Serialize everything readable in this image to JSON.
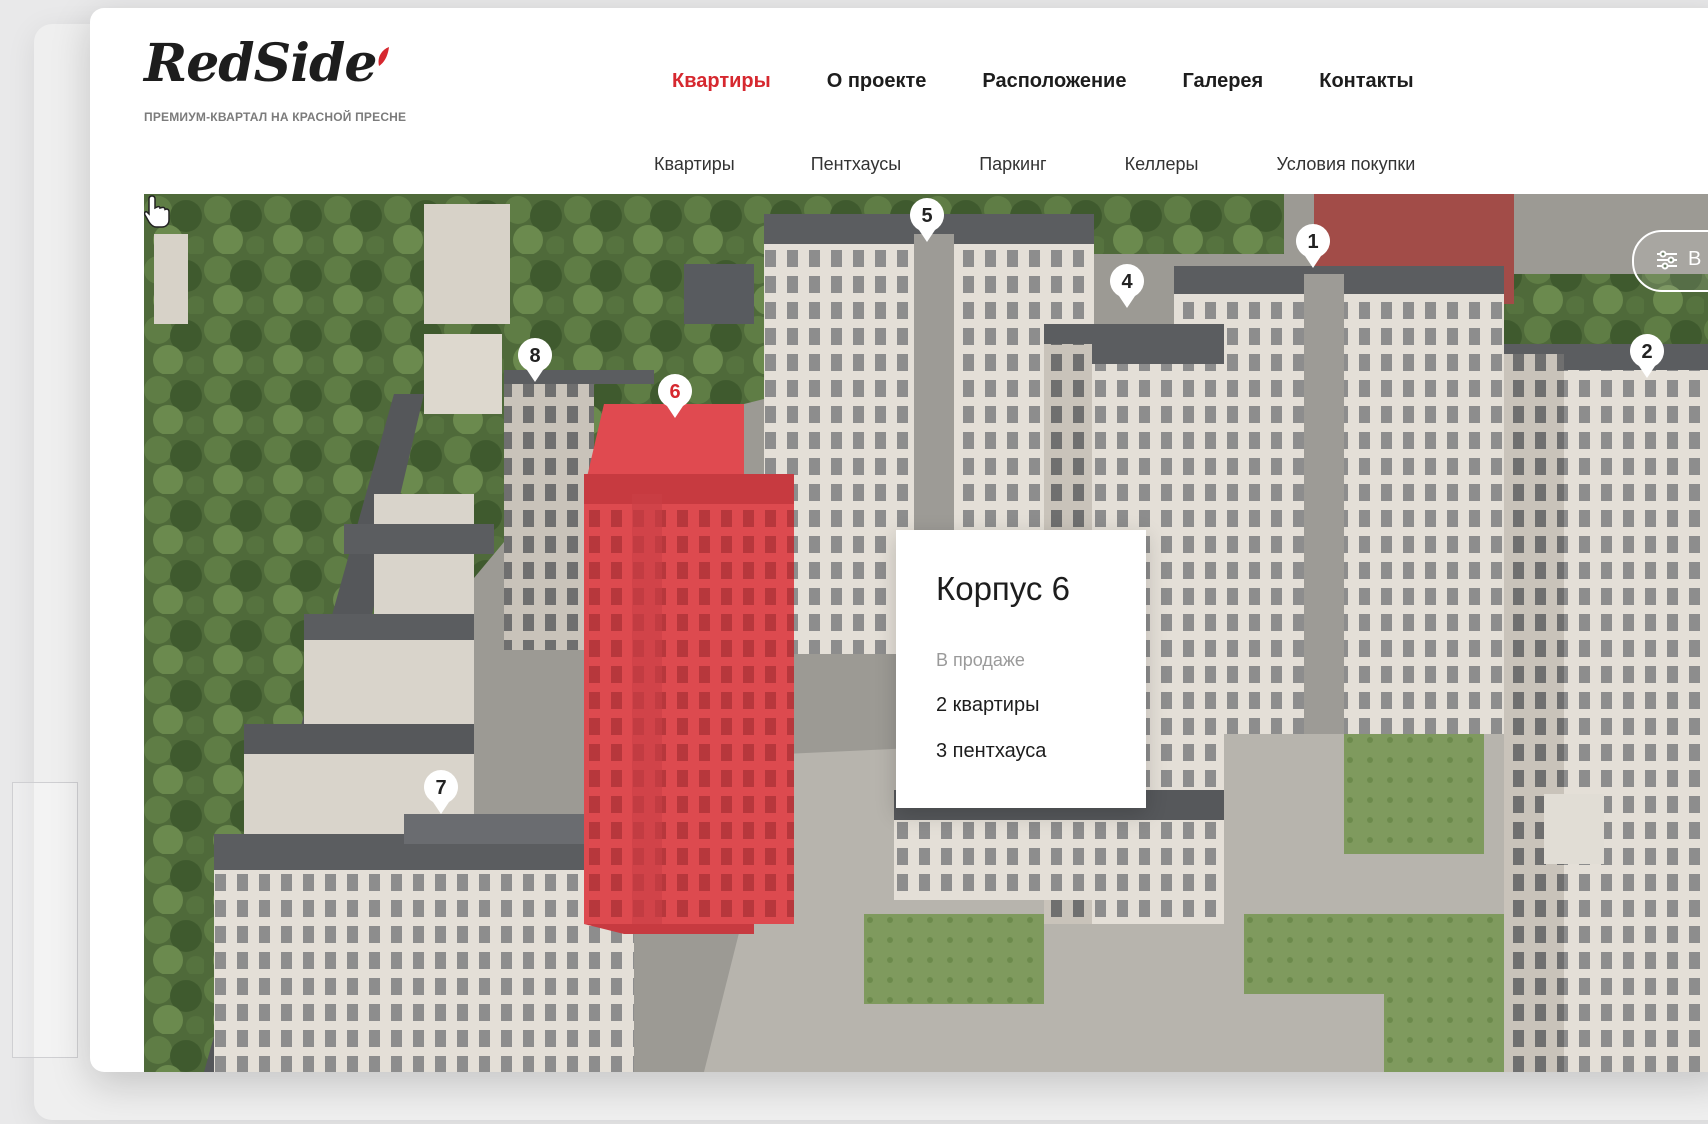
{
  "brand": {
    "logo_text": "RedSide",
    "tagline": "ПРЕМИУМ-КВАРТАЛ НА КРАСНОЙ ПРЕСНЕ",
    "accent_color": "#d6282f"
  },
  "main_nav": [
    {
      "label": "Квартиры",
      "active": true
    },
    {
      "label": "О проекте",
      "active": false
    },
    {
      "label": "Расположение",
      "active": false
    },
    {
      "label": "Галерея",
      "active": false
    },
    {
      "label": "Контакты",
      "active": false
    }
  ],
  "sub_nav": [
    {
      "label": "Квартиры",
      "active": true
    },
    {
      "label": "Пентхаусы",
      "active": false
    },
    {
      "label": "Паркинг",
      "active": false
    },
    {
      "label": "Келлеры",
      "active": false
    },
    {
      "label": "Условия покупки",
      "active": false
    }
  ],
  "scene": {
    "filter_button_label": "В",
    "filter_icon": "sliders-icon",
    "building_markers": [
      "1",
      "2",
      "4",
      "5",
      "6",
      "7",
      "8"
    ],
    "selected_building": "6",
    "highlight_color": "#e0454b"
  },
  "popup": {
    "title": "Корпус 6",
    "status": "В продаже",
    "line1": "2 квартиры",
    "line2": "3 пентхауса"
  }
}
